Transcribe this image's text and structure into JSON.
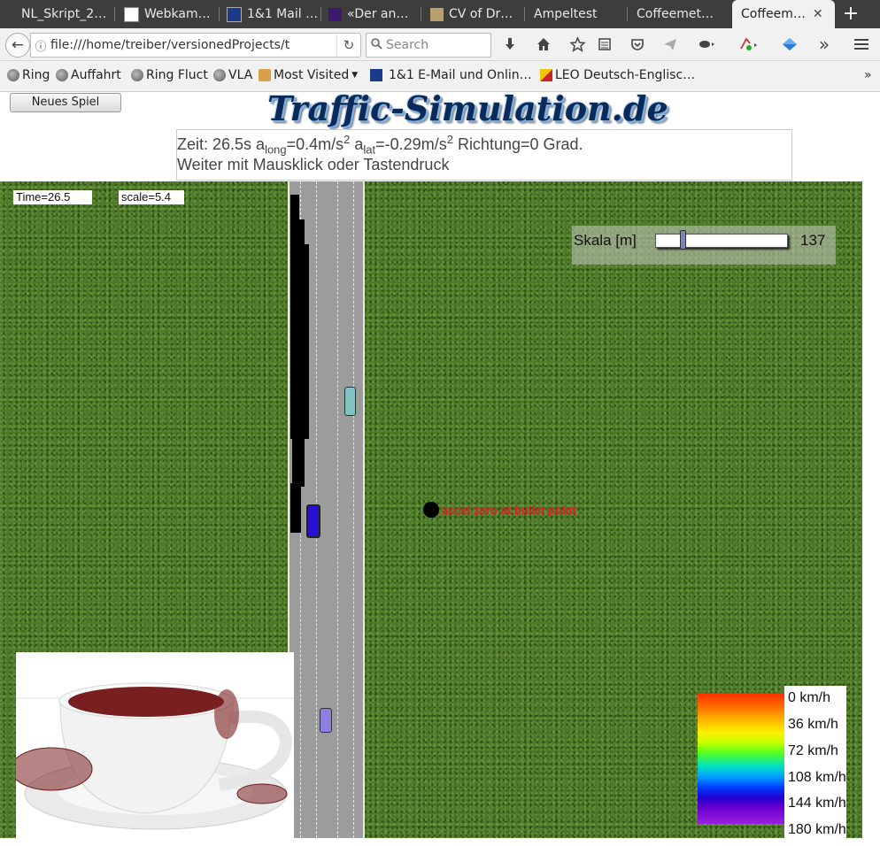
{
  "tabs": [
    {
      "title": "NL_Skript_2…"
    },
    {
      "title": "Webkam…"
    },
    {
      "title": "1&1 Mail …"
    },
    {
      "title": "«Der an…"
    },
    {
      "title": "CV of Dr…"
    },
    {
      "title": "Ampeltest"
    },
    {
      "title": "Coffeemet…"
    },
    {
      "title": "Coffeem…",
      "active": true
    }
  ],
  "nav": {
    "url": "file:///home/treiber/versionedProjects/t",
    "search_placeholder": "Search"
  },
  "bookmarks": [
    {
      "label": "Ring",
      "icon": "globe-icon"
    },
    {
      "label": "Auffahrt",
      "icon": "globe-icon"
    },
    {
      "label": "Ring Fluct",
      "icon": "globe-icon"
    },
    {
      "label": "VLA",
      "icon": "globe-icon"
    },
    {
      "label": "Most Visited",
      "icon": "folder-icon"
    },
    {
      "label": "1&1 E-Mail und Onlin…",
      "icon": "mail-icon"
    },
    {
      "label": "LEO Deutsch-Englisc…",
      "icon": "leo-icon"
    }
  ],
  "page": {
    "new_game_button": "Neues Spiel",
    "logo_text": "Traffic-Simulation.de",
    "info": {
      "zeit": "Zeit: 26.5s a",
      "long_sub": "long",
      "along": "=0.4m/s",
      "sq1": "2",
      "a2": " a",
      "lat_sub": "lat",
      "alat": "=-0.29m/s",
      "sq2": "2",
      "richtung": " Richtung=0 Grad.",
      "line2": "Weiter mit Mausklick oder Tastendruck"
    }
  },
  "sim": {
    "time_label": "Time=26.5",
    "scale_label": "scale=5.4",
    "slider": {
      "label": "Skala [m]",
      "value": "137"
    },
    "marker_text": "accel zero at bullet point",
    "legend": [
      "0 km/h",
      "36 km/h",
      "72 km/h",
      "108 km/h",
      "144 km/h",
      "180 km/h"
    ]
  },
  "colors": {
    "tabbar_bg": "#3d3d3d",
    "grass": "#4c7a2a",
    "road": "#9c9c9c",
    "marker_text": "#e02020",
    "coffee": "#7a1f1f"
  }
}
